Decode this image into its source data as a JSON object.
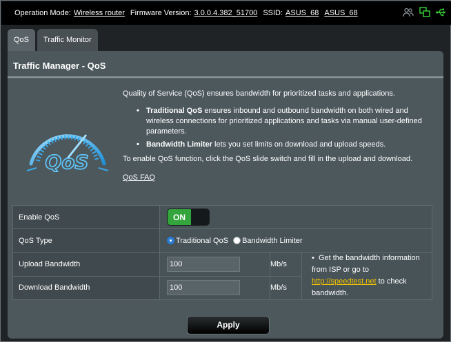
{
  "topbar": {
    "op_mode_label": "Operation Mode:",
    "op_mode_value": "Wireless router",
    "firmware_label": "Firmware Version:",
    "firmware_value": "3.0.0.4.382_51700",
    "ssid_label": "SSID:",
    "ssid_1": "ASUS_68",
    "ssid_2": "ASUS_68",
    "icons": [
      "users-icon",
      "network-status-icon",
      "usb-icon"
    ]
  },
  "tabs": [
    {
      "label": "QoS",
      "active": true
    },
    {
      "label": "Traffic Monitor",
      "active": false
    }
  ],
  "panel": {
    "title": "Traffic Manager - QoS"
  },
  "logo": {
    "text": "QoS"
  },
  "description": {
    "intro": "Quality of Service (QoS) ensures bandwidth for prioritized tasks and applications.",
    "bullet1_bold": "Traditional QoS",
    "bullet1_text": " ensures inbound and outbound bandwidth on both wired and wireless connections for prioritized applications and tasks via manual user-defined parameters.",
    "bullet2_bold": "Bandwidth Limiter",
    "bullet2_text": " lets you set limits on download and upload speeds.",
    "enable_hint": "To enable QoS function, click the QoS slide switch and fill in the upload and download.",
    "faq_link": "QoS FAQ"
  },
  "settings": {
    "enable_qos_label": "Enable QoS",
    "enable_qos_value": "ON",
    "qos_type_label": "QoS Type",
    "qos_type_options": [
      "Traditional QoS",
      "Bandwidth Limiter"
    ],
    "qos_type_selected": "Traditional QoS",
    "upload_label": "Upload Bandwidth",
    "upload_value": "100",
    "upload_unit": "Mb/s",
    "download_label": "Download Bandwidth",
    "download_value": "100",
    "download_unit": "Mb/s",
    "note_prefix": "Get the bandwidth information from ISP or go to ",
    "note_link": "http://speedtest.net",
    "note_suffix": " to check bandwidth."
  },
  "apply_label": "Apply",
  "colors": {
    "toggle_on": "#34a43c",
    "radio_selected": "#2b7cd4",
    "link_yellow": "#f5c400",
    "usb_icon_green": "#32c832"
  }
}
